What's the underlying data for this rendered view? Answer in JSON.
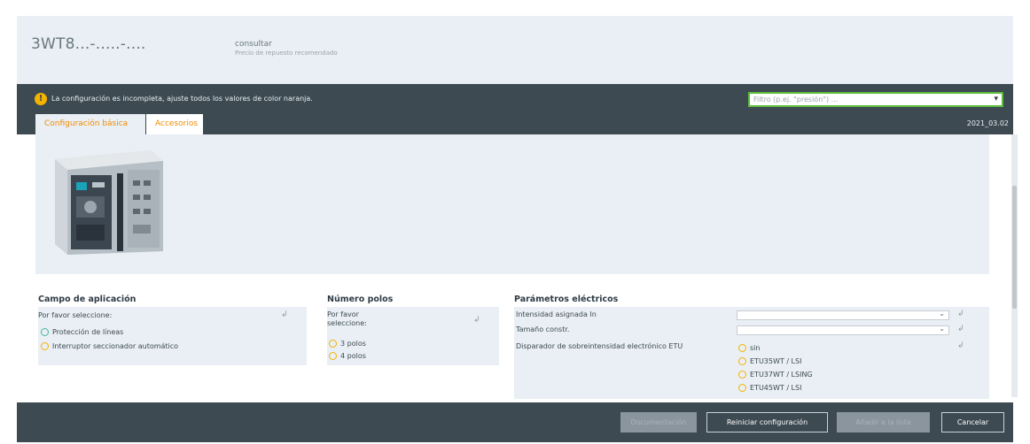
{
  "header": {
    "product_code": "3WT8...-.....-....",
    "price_label": "consultar",
    "price_sublabel": "Precio de repuesto recomendado"
  },
  "status": {
    "warning": "La configuración es incompleta, ajuste todos los valores de color naranja.",
    "select_placeholder": "Filtro (p.ej. \"presión\") ...",
    "version": "2021_03.02"
  },
  "tabs": [
    {
      "label": "Configuración básica",
      "active": true
    },
    {
      "label": "Accesorios",
      "active": false
    }
  ],
  "sections": {
    "campo": {
      "title": "Campo de aplicación",
      "prompt": "Por favor seleccione:",
      "options": [
        "Protección de líneas",
        "Interruptor seccionador automático"
      ]
    },
    "polos": {
      "title": "Número polos",
      "prompt_line1": "Por favor",
      "prompt_line2": "seleccione:",
      "options": [
        "3 polos",
        "4 polos"
      ]
    },
    "electricos": {
      "title": "Parámetros eléctricos",
      "rows": [
        "Intensidad asignada In",
        "Tamaño constr.",
        "Disparador de sobreintensidad electrónico ETU"
      ],
      "etu_options": [
        "sin",
        "ETU35WT / LSI",
        "ETU37WT / LSING",
        "ETU45WT / LSI"
      ]
    }
  },
  "footer": {
    "btn1": "Documentación",
    "btn2": "Reiniciar configuración",
    "btn3": "Añadir a la lista",
    "btn4": "Cancelar"
  },
  "colors": {
    "accent_orange": "#f28c00",
    "dark_bar": "#3d4a52",
    "panel_bg": "#e9eff4",
    "filter_border": "#5dbd3c",
    "warning_icon": "#f5b300"
  }
}
